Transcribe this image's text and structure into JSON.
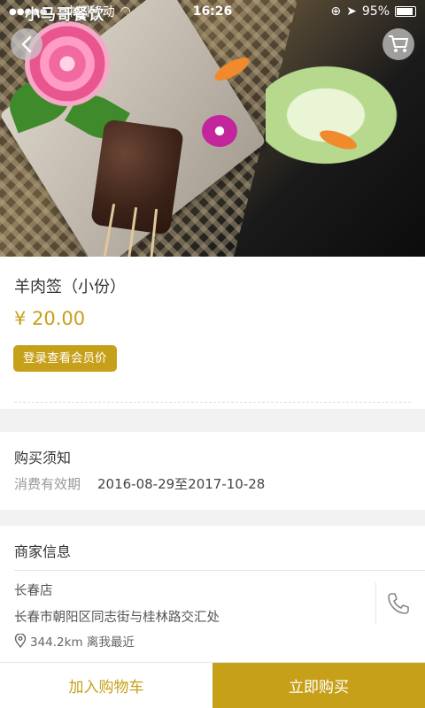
{
  "status_bar": {
    "carrier": "中国移动",
    "brand_overlay": "小马哥餐饮",
    "time": "16:26",
    "battery": "95%"
  },
  "hero": {
    "image_description_icon": "food-photo",
    "back_icon": "chevron-left-icon",
    "cart_icon": "cart-icon"
  },
  "product": {
    "name": "羊肉签（小份）",
    "price": "¥ 20.00",
    "member_button": "登录查看会员价"
  },
  "notice": {
    "title": "购买须知",
    "period_label": "消费有效期",
    "period_value": "2016-08-29至2017-10-28"
  },
  "merchant": {
    "title": "商家信息",
    "store_name": "长春店",
    "address": "长春市朝阳区同志街与桂林路交汇处",
    "distance": "344.2km  离我最近",
    "phone_icon": "phone-icon",
    "location_icon": "location-pin-icon"
  },
  "bottom_bar": {
    "add_to_cart": "加入购物车",
    "buy_now": "立即购买"
  },
  "colors": {
    "accent": "#c7a01a",
    "background": "#f2f2f2"
  }
}
